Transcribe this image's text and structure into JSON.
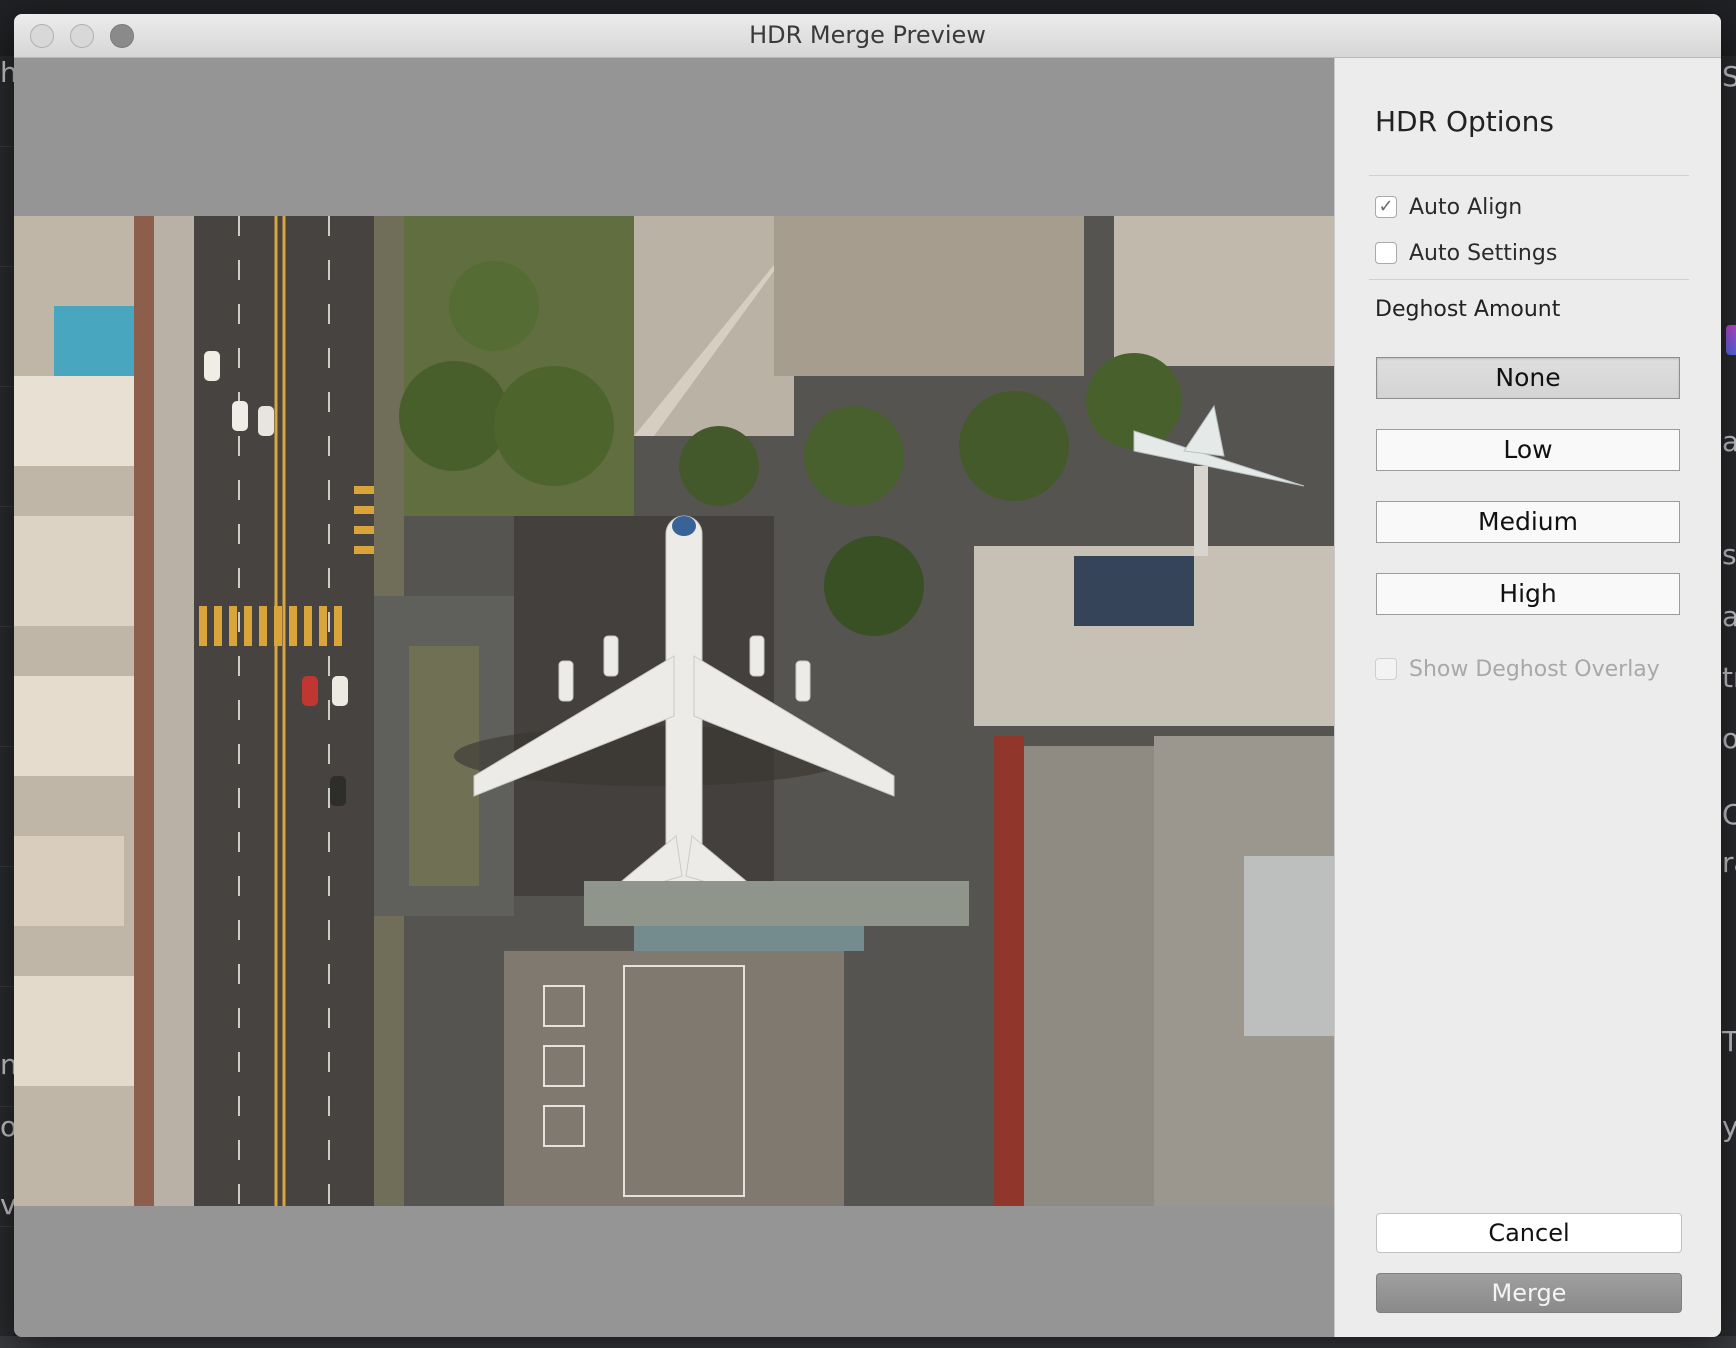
{
  "window": {
    "title": "HDR Merge Preview"
  },
  "panel": {
    "title": "HDR Options",
    "auto_align": {
      "label": "Auto Align",
      "checked": true
    },
    "auto_settings": {
      "label": "Auto Settings",
      "checked": false
    },
    "deghost": {
      "label": "Deghost Amount",
      "options": [
        "None",
        "Low",
        "Medium",
        "High"
      ],
      "selected": "None"
    },
    "show_overlay": {
      "label": "Show Deghost Overlay",
      "checked": false,
      "disabled": true
    },
    "cancel_label": "Cancel",
    "merge_label": "Merge"
  },
  "background_fragments": {
    "left": [
      "h",
      "n",
      "oc",
      "vi"
    ],
    "right": [
      "S",
      "al",
      "s",
      "al",
      "tr",
      "o",
      "Cla",
      "ra",
      "Ta",
      "y"
    ]
  },
  "colors": {
    "preview_bg": "#959595",
    "panel_bg": "#ececec",
    "merge_button": "#8f8f8f"
  }
}
